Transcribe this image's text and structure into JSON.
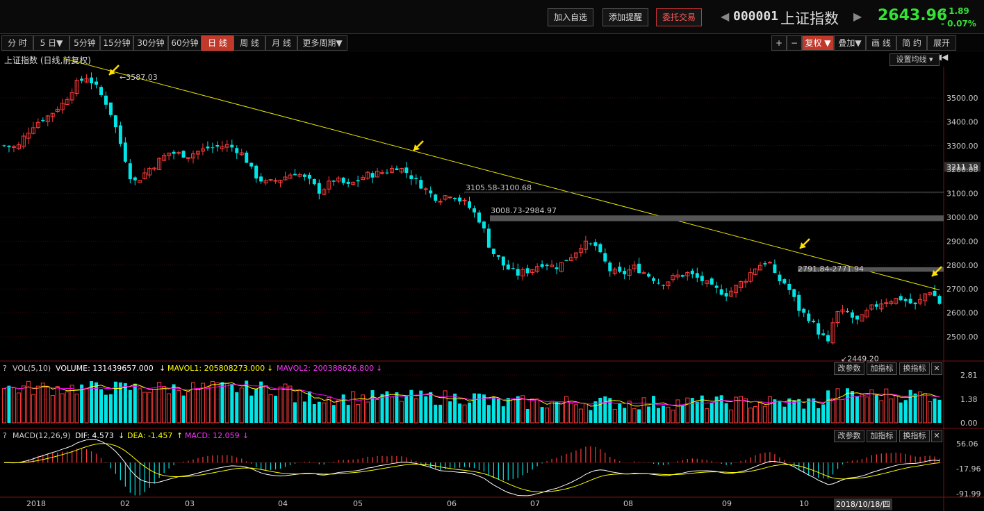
{
  "header": {
    "add_watchlist_label": "加入自选",
    "add_alert_label": "添加提醒",
    "trade_label": "委托交易",
    "stock_code": "000001",
    "stock_name": "上证指数",
    "last_price": "2643.96",
    "change": "- 1.89",
    "change_pct": "- 0.07%",
    "change_color": "#35e135"
  },
  "period_tabs": [
    {
      "label": "分 时",
      "active": false
    },
    {
      "label": "5 日▼",
      "active": false
    },
    {
      "label": "5分钟",
      "active": false
    },
    {
      "label": "15分钟",
      "active": false
    },
    {
      "label": "30分钟",
      "active": false
    },
    {
      "label": "60分钟",
      "active": false
    },
    {
      "label": "日 线",
      "active": true
    },
    {
      "label": "周 线",
      "active": false
    },
    {
      "label": "月 线",
      "active": false
    },
    {
      "label": "更多周期▼",
      "active": false
    }
  ],
  "right_tools": [
    {
      "label": "+",
      "active": false
    },
    {
      "label": "−",
      "active": false
    },
    {
      "label": "复权 ▼",
      "active": true
    },
    {
      "label": "叠加▼",
      "active": false
    },
    {
      "label": "画 线",
      "active": false
    },
    {
      "label": "简 约",
      "active": false
    },
    {
      "label": "展开 ◀◀",
      "active": false
    }
  ],
  "chart": {
    "title": "上证指数 (日线,前复权)",
    "ma_setting_label": "设置均线 ▾",
    "price_axis_labels": [
      "3500.00",
      "3400.00",
      "3300.00",
      "3211.19",
      "3200.00",
      "3100.00",
      "3000.00",
      "2900.00",
      "2800.00",
      "2700.00",
      "2600.00",
      "2500.00"
    ],
    "price_axis_values": [
      3500,
      3400,
      3300,
      3211.19,
      3200,
      3100,
      3000,
      2900,
      2800,
      2700,
      2600,
      2500
    ],
    "annotations": {
      "high": "3587.03",
      "low": "2449.20",
      "gap1": "3105.58-3100.68",
      "gap2": "3008.73-2984.97",
      "gap3": "2791.84-2771.94"
    },
    "month_labels": [
      "2018",
      "02",
      "03",
      "04",
      "05",
      "06",
      "07",
      "08",
      "09",
      "10"
    ],
    "selected_date": "2018/10/18/四",
    "up_color": "#ff3b3b",
    "down_color": "#00e5e5",
    "trendline_color": "#e6e600",
    "arrow_color": "#ffe000"
  },
  "volume": {
    "indicator": "VOL(5,10)",
    "volume_text": "VOLUME: 131439657.000",
    "mavol1_text": "MAVOL1: 205808273.000",
    "mavol2_text": "MAVOL2: 200388626.800",
    "axis_labels": [
      "2.81",
      "1.38",
      "0.00"
    ],
    "axis_values": [
      2.81,
      1.38,
      0.0
    ],
    "mavol1_color": "#ffff00",
    "mavol2_color": "#ff00ff"
  },
  "macd": {
    "indicator": "MACD(12,26,9)",
    "dif_text": "DIF: 4.573",
    "dea_text": "DEA: -1.457",
    "macd_text": "MACD: 12.059",
    "axis_labels": [
      "56.06",
      "-17.96",
      "-91.99"
    ],
    "axis_values": [
      56.06,
      -17.96,
      -91.99
    ]
  },
  "panel_buttons": {
    "params": "改参数",
    "add_indicator": "加指标",
    "swap_indicator": "换指标",
    "close": "✕",
    "question": "?"
  }
}
